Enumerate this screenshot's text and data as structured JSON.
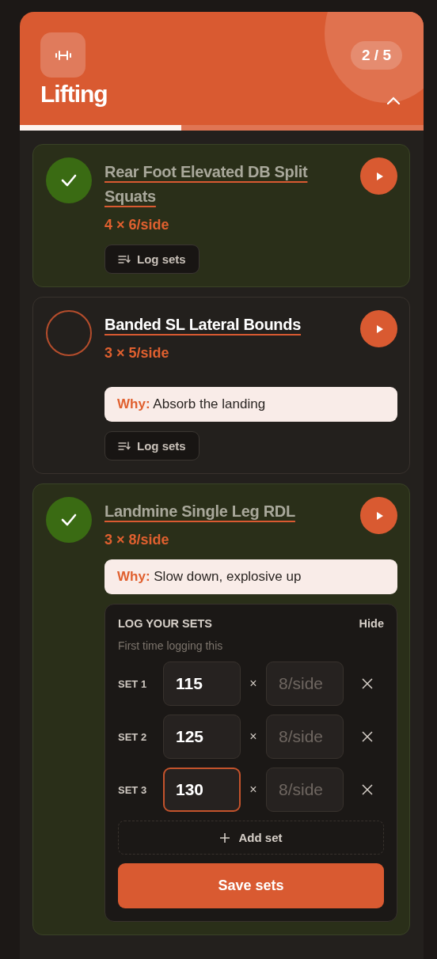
{
  "header": {
    "title": "Lifting",
    "progress_text": "2 / 5",
    "level": 0.4,
    "expanded": true
  },
  "exercises": [
    {
      "title": "Rear Foot Elevated DB Split Squats",
      "prescription": "4 × 6/side",
      "done": true,
      "log_button": "Log sets"
    },
    {
      "title": "Banded SL Lateral Bounds",
      "prescription": "3 × 5/side",
      "done": false,
      "why_label": "Why:",
      "why": "Absorb the landing",
      "log_button": "Log sets"
    },
    {
      "title": "Landmine Single Leg RDL",
      "prescription": "3 × 8/side",
      "done": true,
      "why_label": "Why:",
      "why": "Slow down, explosive up",
      "log_panel": {
        "title": "LOG YOUR SETS",
        "hide": "Hide",
        "subtitle": "First time logging this",
        "sets": [
          {
            "label": "SET 1",
            "weight": "115",
            "separator": "×",
            "reps_placeholder": "8/side",
            "focused": false
          },
          {
            "label": "SET 2",
            "weight": "125",
            "separator": "×",
            "reps_placeholder": "8/side",
            "focused": false
          },
          {
            "label": "SET 3",
            "weight": "130",
            "separator": "×",
            "reps_placeholder": "8/side",
            "focused": true
          }
        ],
        "add_button": "Add set",
        "save_button": "Save sets"
      }
    }
  ]
}
